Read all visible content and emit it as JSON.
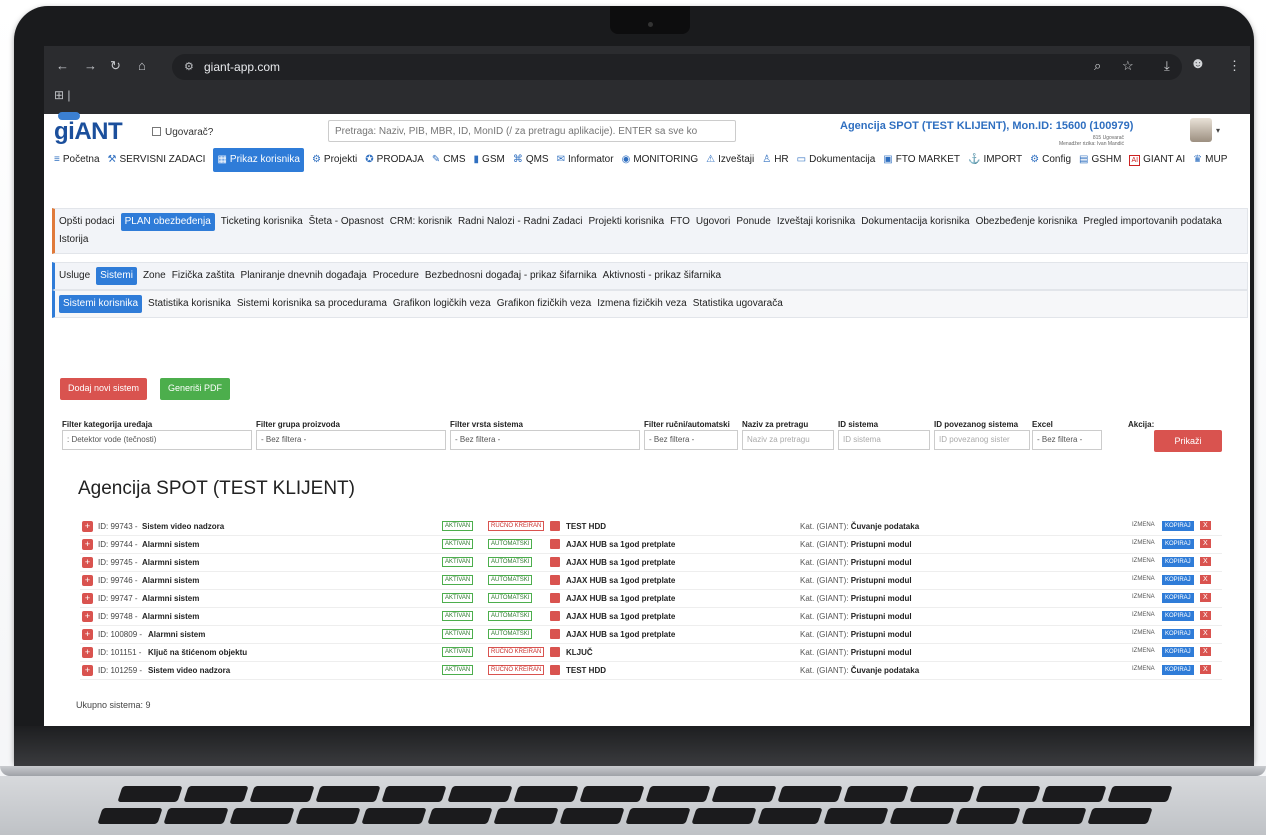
{
  "browser": {
    "url": "giant-app.com",
    "icons": [
      "back-icon",
      "forward-icon",
      "reload-icon",
      "home-icon",
      "site-info-icon",
      "zoom-icon",
      "star-icon",
      "download-icon",
      "profile-icon",
      "menu-icon",
      "apps-icon"
    ]
  },
  "header": {
    "logo": "giANT",
    "ugovarac_label": "Ugovarač?",
    "search_placeholder": "Pretraga: Naziv, PIB, MBR, ID, MonID (/ za pretragu aplikacije). ENTER sa sve ko",
    "agency": "Agencija SPOT (TEST KLIJENT), Mon.ID: 15600 (100979)",
    "manager_line1": "815 Ugovarač",
    "manager_line2": "Menadžer rizika: Ivan Mandić"
  },
  "main_menu": [
    {
      "label": "Početna",
      "icon": "≡"
    },
    {
      "label": "SERVISNI ZADACI",
      "icon": "⚒"
    },
    {
      "label": "Prikaz korisnika",
      "icon": "▦",
      "active": true
    },
    {
      "label": "Projekti",
      "icon": "⚙"
    },
    {
      "label": "PRODAJA",
      "icon": "✪"
    },
    {
      "label": "CMS",
      "icon": "✎"
    },
    {
      "label": "GSM",
      "icon": "▮"
    },
    {
      "label": "QMS",
      "icon": "⌘"
    },
    {
      "label": "Informator",
      "icon": "✉"
    },
    {
      "label": "MONITORING",
      "icon": "◉"
    },
    {
      "label": "Izveštaji",
      "icon": "⚠"
    },
    {
      "label": "HR",
      "icon": "♙"
    },
    {
      "label": "Dokumentacija",
      "icon": "▭"
    },
    {
      "label": "FTO MARKET",
      "icon": "▣"
    },
    {
      "label": "IMPORT",
      "icon": "⚓"
    },
    {
      "label": "Config",
      "icon": "⚙"
    },
    {
      "label": "GSHM",
      "icon": "▤"
    },
    {
      "label": "GIANT AI",
      "icon": "AI"
    },
    {
      "label": "MUP",
      "icon": "♛"
    }
  ],
  "tabs_level1": [
    "Opšti podaci",
    "PLAN obezbeđenja",
    "Ticketing korisnika",
    "Šteta - Opasnost",
    "CRM: korisnik",
    "Radni Nalozi - Radni Zadaci",
    "Projekti korisnika",
    "FTO",
    "Ugovori",
    "Ponude",
    "Izveštaji korisnika",
    "Dokumentacija korisnika",
    "Obezbeđenje korisnika",
    "Pregled importovanih podataka",
    "Istorija"
  ],
  "tabs_level1_active": 1,
  "tabs_level2": [
    "Usluge",
    "Sistemi",
    "Zone",
    "Fizička zaštita",
    "Planiranje dnevnih događaja",
    "Procedure",
    "Bezbednosni događaj - prikaz šifarnika",
    "Aktivnosti - prikaz šifarnika"
  ],
  "tabs_level2_active": 1,
  "tabs_level3": [
    "Sistemi korisnika",
    "Statistika korisnika",
    "Sistemi korisnika sa procedurama",
    "Grafikon logičkih veza",
    "Grafikon fizičkih veza",
    "Izmena fizičkih veza",
    "Statistika ugovarača"
  ],
  "tabs_level3_active": 0,
  "buttons": {
    "add_system": "Dodaj novi sistem",
    "generate_pdf": "Generiši PDF",
    "show": "Prikaži"
  },
  "filters": {
    "kategorija_label": "Filter kategorija uređaja",
    "kategorija_value": ": Detektor vode (tečnosti)",
    "grupa_label": "Filter grupa proizvoda",
    "grupa_value": "- Bez filtera -",
    "vrsta_label": "Filter vrsta sistema",
    "vrsta_value": "- Bez filtera -",
    "rucni_label": "Filter ručni/automatski",
    "rucni_value": "- Bez filtera -",
    "naziv_label": "Naziv za pretragu",
    "naziv_placeholder": "Naziv za pretragu",
    "id_label": "ID sistema",
    "id_placeholder": "ID sistema",
    "idpov_label": "ID povezanog sistema",
    "idpov_placeholder": "ID povezanog sister",
    "excel_label": "Excel",
    "excel_value": "- Bez filtera -",
    "akcija_label": "Akcija:"
  },
  "panel": {
    "title": "Agencija SPOT (TEST KLIJENT)",
    "total": "Ukupno sistema: 9",
    "status_label": "AKTIVAN",
    "edit_label": "IZMENA",
    "copy_label": "KOPIRAJ",
    "delete_label": "X",
    "plus_label": "+",
    "kat_prefix": "Kat. (GIANT):"
  },
  "systems": [
    {
      "id": "ID: 99743 -",
      "name": "Sistem video nadzora",
      "mode": "RUČNO KREIRAN",
      "product": "TEST HDD",
      "kat": "Čuvanje podataka"
    },
    {
      "id": "ID: 99744 -",
      "name": "Alarmni sistem",
      "mode": "AUTOMATSKI",
      "product": "AJAX HUB sa 1god pretplate",
      "kat": "Pristupni modul"
    },
    {
      "id": "ID: 99745 -",
      "name": "Alarmni sistem",
      "mode": "AUTOMATSKI",
      "product": "AJAX HUB sa 1god pretplate",
      "kat": "Pristupni modul"
    },
    {
      "id": "ID: 99746 -",
      "name": "Alarmni sistem",
      "mode": "AUTOMATSKI",
      "product": "AJAX HUB sa 1god pretplate",
      "kat": "Pristupni modul"
    },
    {
      "id": "ID: 99747 -",
      "name": "Alarmni sistem",
      "mode": "AUTOMATSKI",
      "product": "AJAX HUB sa 1god pretplate",
      "kat": "Pristupni modul"
    },
    {
      "id": "ID: 99748 -",
      "name": "Alarmni sistem",
      "mode": "AUTOMATSKI",
      "product": "AJAX HUB sa 1god pretplate",
      "kat": "Pristupni modul"
    },
    {
      "id": "ID: 100809 -",
      "name": "Alarmni sistem",
      "mode": "AUTOMATSKI",
      "product": "AJAX HUB sa 1god pretplate",
      "kat": "Pristupni modul"
    },
    {
      "id": "ID: 101151 -",
      "name": "Ključ na štićenom objektu",
      "mode": "RUČNO KREIRAN",
      "product": "KLJUČ",
      "kat": "Pristupni modul"
    },
    {
      "id": "ID: 101259 -",
      "name": "Sistem video nadzora",
      "mode": "RUČNO KREIRAN",
      "product": "TEST HDD",
      "kat": "Čuvanje podataka"
    }
  ]
}
